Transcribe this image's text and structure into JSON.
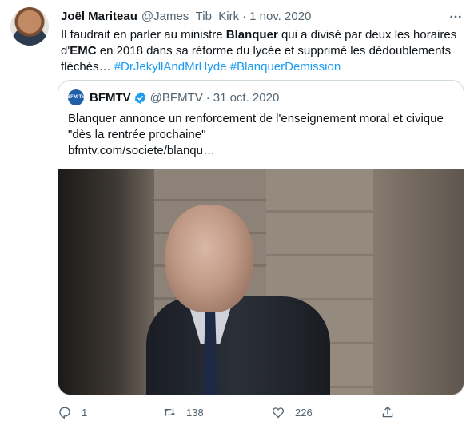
{
  "tweet": {
    "author_name": "Joël Mariteau",
    "author_handle": "@James_Tib_Kirk",
    "separator": "·",
    "date": "1 nov. 2020",
    "text": {
      "part1": "Il faudrait en parler au ministre ",
      "bold1": "Blanquer",
      "part2": " qui a divisé par deux les horaires d'",
      "bold2": "EMC",
      "part3": " en 2018 dans sa réforme du lycée et supprimé les dédoublements fléchés… ",
      "hashtag1": "#DrJekyllAndMrHyde",
      "hashtag2": "#BlanquerDemission"
    }
  },
  "quote": {
    "logo_text": "BFM TV",
    "name": "BFMTV",
    "handle": "@BFMTV",
    "separator": "·",
    "date": "31 oct. 2020",
    "text": "Blanquer annonce un renforcement de l'enseignement moral et civique \"dès la rentrée prochaine\"",
    "link": "bfmtv.com/societe/blanqu…"
  },
  "actions": {
    "reply_count": "1",
    "retweet_count": "138",
    "like_count": "226"
  },
  "icons": {
    "more": "more-icon",
    "verified": "verified-icon",
    "reply": "reply-icon",
    "retweet": "retweet-icon",
    "like": "like-icon",
    "share": "share-icon"
  },
  "colors": {
    "accent": "#1d9bf0",
    "text": "#0f1419",
    "secondary": "#536471",
    "border": "#cfd9de"
  }
}
